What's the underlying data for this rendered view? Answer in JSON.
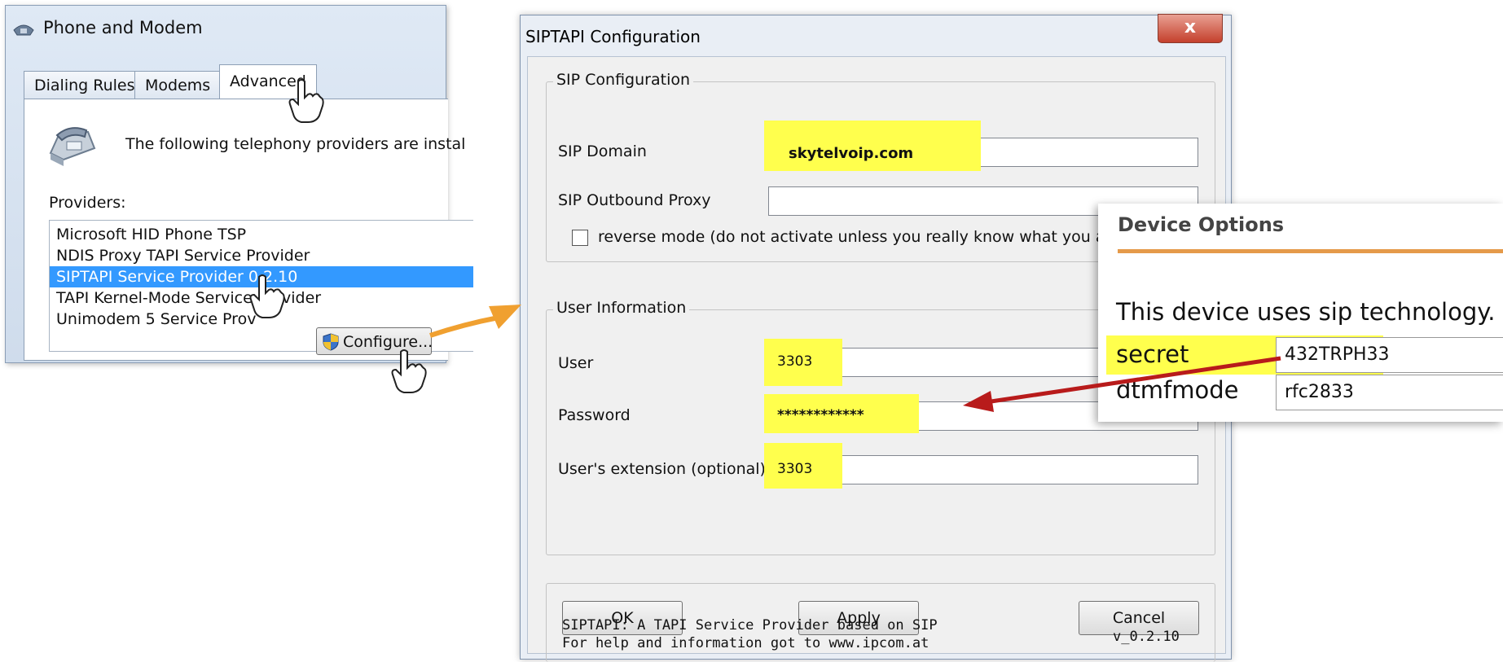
{
  "phone_modem": {
    "title": "Phone and Modem",
    "tabs": [
      "Dialing Rules",
      "Modems",
      "Advanced"
    ],
    "active_tab": "Advanced",
    "description": "The following telephony providers are instal",
    "providers_label": "Providers:",
    "providers": [
      "Microsoft HID Phone TSP",
      "NDIS Proxy TAPI Service Provider",
      "SIPTAPI Service Provider 0.2.10",
      "TAPI Kernel-Mode Service Provider",
      "Unimodem 5 Service Prov"
    ],
    "selected_provider_index": 2,
    "configure_label": "Configure..."
  },
  "sip_dialog": {
    "title": "SIPTAPI Configuration",
    "close_label": "x",
    "sip_config": {
      "legend": "SIP Configuration",
      "domain_label": "SIP Domain",
      "domain_value": "skytelvoip.com",
      "proxy_label": "SIP Outbound Proxy",
      "proxy_value": "",
      "reverse_label": "reverse mode (do not activate unless you really know what you ar",
      "reverse_checked": false
    },
    "user_info": {
      "legend": "User Information",
      "user_label": "User",
      "user_value": "3303",
      "password_label": "Password",
      "password_value": "************",
      "extension_label": "User's extension (optional)",
      "extension_value": "3303"
    },
    "buttons": {
      "ok": "OK",
      "apply": "Apply",
      "cancel": "Cancel"
    },
    "footer_line1": "SIPTAPI: A TAPI Service Provider based on SIP",
    "footer_line2": "For help and information got to www.ipcom.at",
    "version": "v_0.2.10"
  },
  "device_options": {
    "title": "Device Options",
    "description": "This device uses sip technology.",
    "rows": [
      {
        "key": "secret",
        "value": "432TRPH33"
      },
      {
        "key": "dtmfmode",
        "value": "rfc2833"
      }
    ]
  },
  "colors": {
    "highlight": "#ffff4d",
    "selection": "#3399ff",
    "orange_arrow": "#f0a030",
    "red_arrow": "#b81b1b",
    "device_rule": "#e59a4a"
  }
}
